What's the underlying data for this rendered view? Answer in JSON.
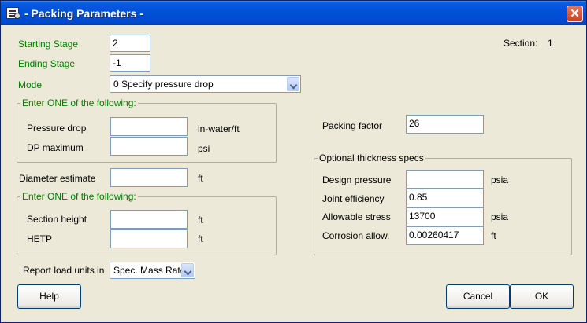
{
  "window": {
    "title": "- Packing Parameters -",
    "close_label": "✕"
  },
  "section": {
    "label": "Section:",
    "value": "1"
  },
  "stage": {
    "starting_label": "Starting Stage",
    "starting_value": "2",
    "ending_label": "Ending Stage",
    "ending_value": "-1"
  },
  "mode": {
    "label": "Mode",
    "selected": "0 Specify pressure drop"
  },
  "pressure_group": {
    "title": "Enter ONE of the following:",
    "pressure_drop_label": "Pressure drop",
    "pressure_drop_value": "",
    "pressure_drop_unit": "in-water/ft",
    "dp_max_label": "DP maximum",
    "dp_max_value": "",
    "dp_max_unit": "psi"
  },
  "diameter": {
    "label": "Diameter estimate",
    "value": "",
    "unit": "ft"
  },
  "height_group": {
    "title": "Enter ONE of the following:",
    "section_height_label": "Section height",
    "section_height_value": "",
    "section_height_unit": "ft",
    "hetp_label": "HETP",
    "hetp_value": "",
    "hetp_unit": "ft"
  },
  "report": {
    "label": "Report load units in",
    "selected": "Spec. Mass Rate"
  },
  "packing_factor": {
    "label": "Packing factor",
    "value": "26"
  },
  "thickness_group": {
    "title": "Optional thickness specs",
    "design_pressure_label": "Design pressure",
    "design_pressure_value": "",
    "design_pressure_unit": "psia",
    "joint_efficiency_label": "Joint efficiency",
    "joint_efficiency_value": "0.85",
    "allowable_stress_label": "Allowable stress",
    "allowable_stress_value": "13700",
    "allowable_stress_unit": "psia",
    "corrosion_label": "Corrosion allow.",
    "corrosion_value": "0.00260417",
    "corrosion_unit": "ft"
  },
  "buttons": {
    "help": "Help",
    "cancel": "Cancel",
    "ok": "OK"
  }
}
